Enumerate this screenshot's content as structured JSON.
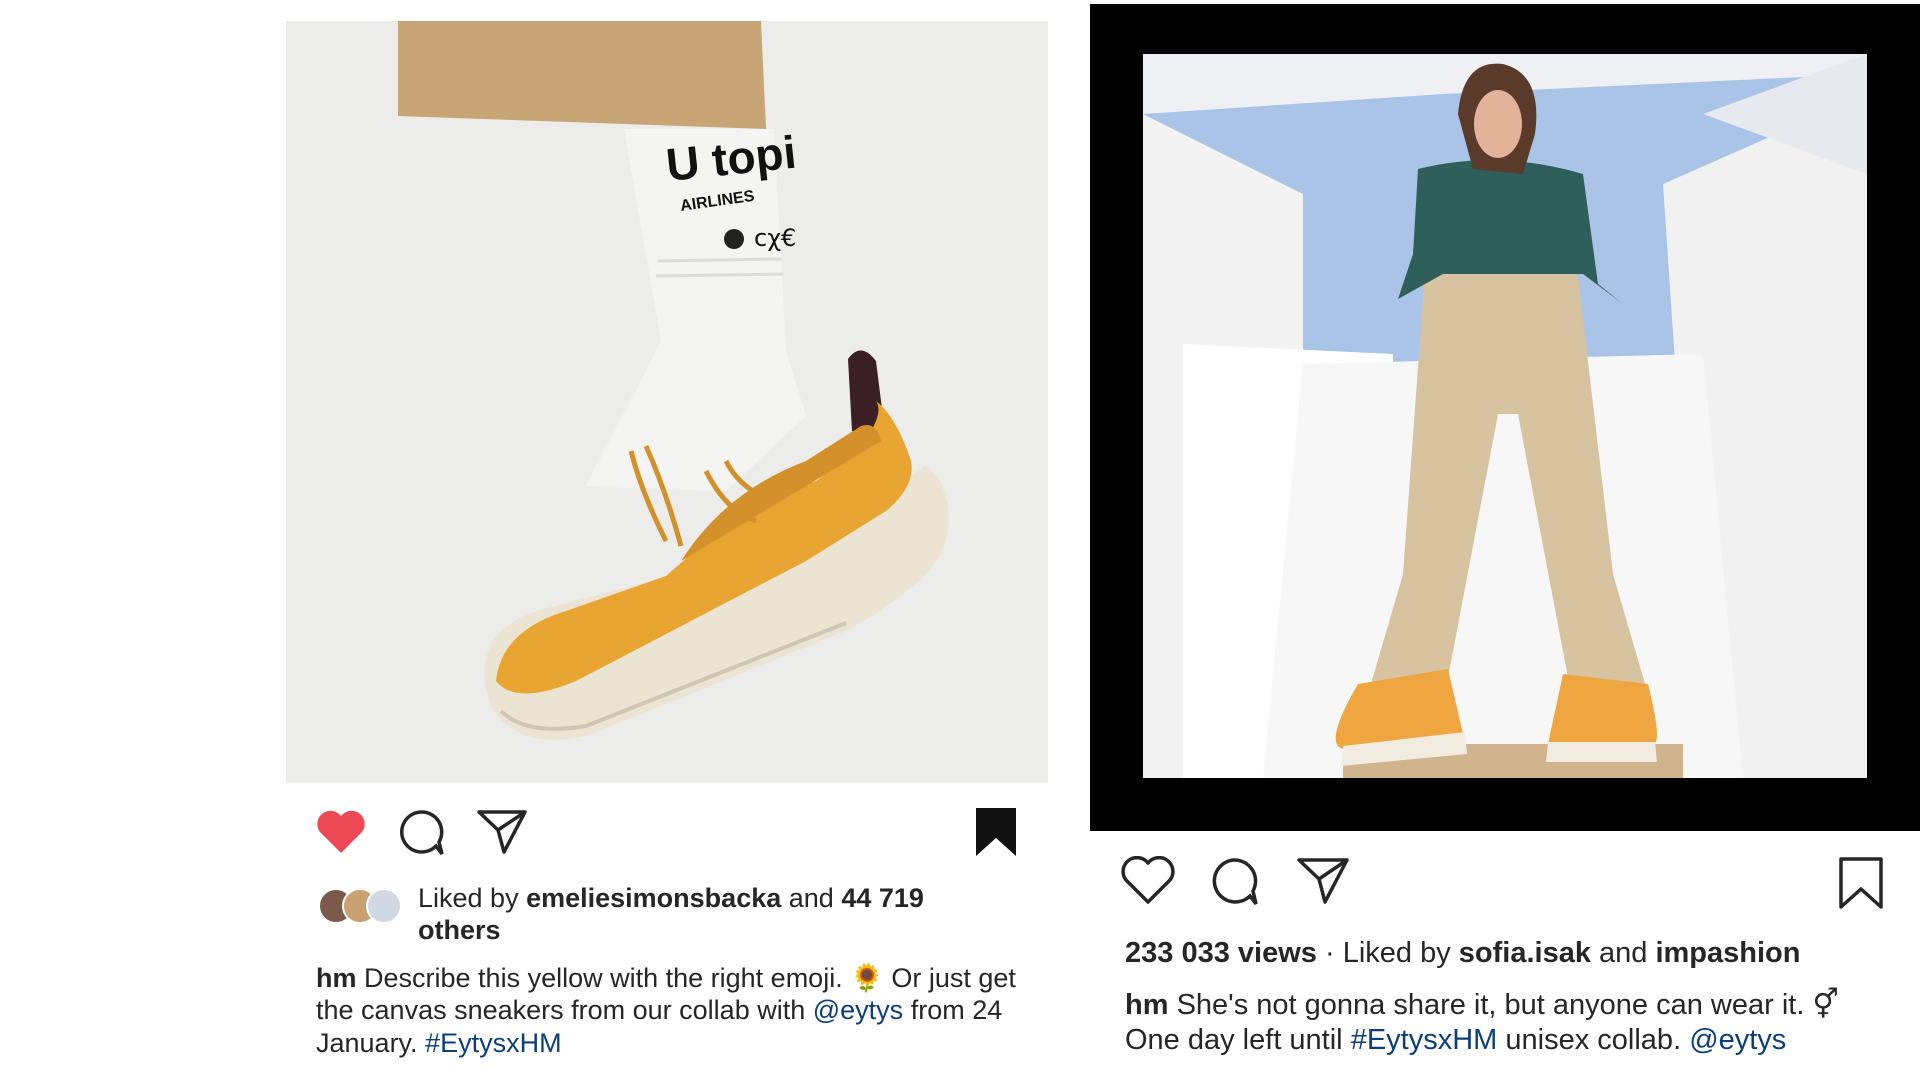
{
  "post_left": {
    "liked": true,
    "saved": true,
    "likes": {
      "prefix": "Liked by",
      "user": "emeliesimonsbacka",
      "joiner": "and",
      "count": "44 719",
      "suffix": "others"
    },
    "caption": {
      "author": "hm",
      "text1": "Describe this yellow with the right emoji.",
      "emoji": "🌻",
      "text2": "Or just get the canvas sneakers from our collab with",
      "mention": "@eytys",
      "text3": "from 24 January.",
      "hashtag": "#EytysxHM"
    },
    "icons": [
      "heart-icon",
      "comment-icon",
      "share-icon",
      "bookmark-icon"
    ],
    "colors": {
      "heart": "#ed4956",
      "link": "#0b3f7a",
      "shoe": "#e8a531"
    }
  },
  "post_right": {
    "liked": false,
    "saved": false,
    "stats": {
      "views": "233 033 views",
      "separator": "·",
      "prefix": "Liked by",
      "user1": "sofia.isak",
      "joiner": "and",
      "user2": "impashion"
    },
    "caption": {
      "author": "hm",
      "text1": "She's not gonna share it, but anyone can wear it.",
      "emoji": "⚥",
      "text2": "One day left until",
      "hashtag": "#EytysxHM",
      "text3": "unisex collab.",
      "mention": "@eytys"
    },
    "icons": [
      "heart-outline-icon",
      "comment-icon",
      "share-icon",
      "bookmark-outline-icon"
    ],
    "colors": {
      "sky": "#a9c4e6",
      "frame": "#000000"
    }
  }
}
